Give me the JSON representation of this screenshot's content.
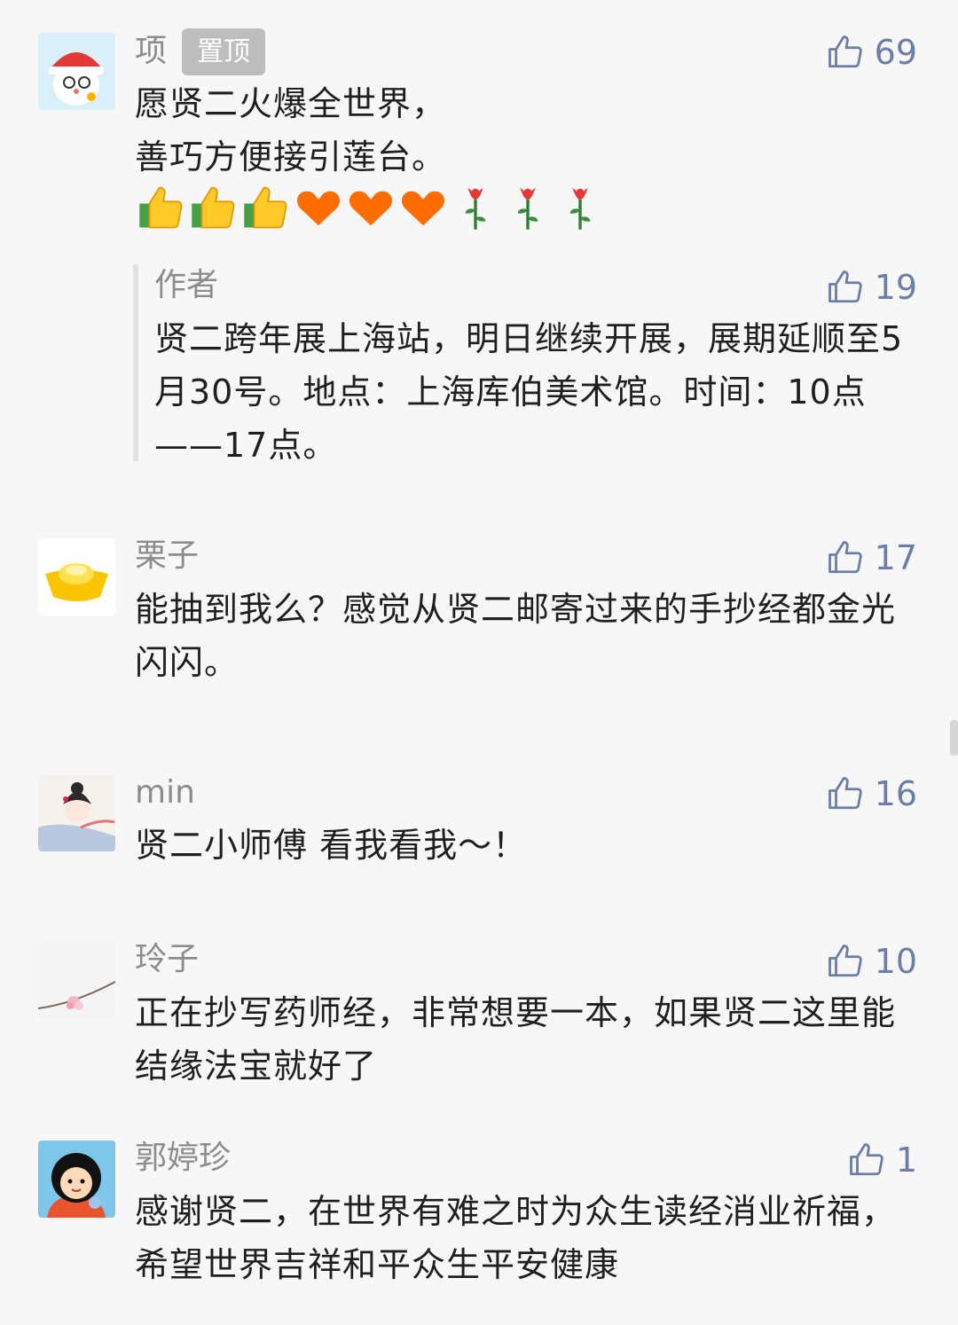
{
  "comments": [
    {
      "name": "项",
      "badge": "置顶",
      "likes": "69",
      "text": "愿贤二火爆全世界，\n善巧方便接引莲台。",
      "emojis": [
        "thumbs-up",
        "thumbs-up",
        "thumbs-up",
        "heart",
        "heart",
        "heart",
        "rose",
        "rose",
        "rose"
      ],
      "reply": {
        "name": "作者",
        "likes": "19",
        "text": "贤二跨年展上海站，明日继续开展，展期延顺至5月30号。地点：上海库伯美术馆。时间：10点——17点。"
      }
    },
    {
      "name": "栗子",
      "likes": "17",
      "text": "能抽到我么？感觉从贤二邮寄过来的手抄经都金光闪闪。"
    },
    {
      "name": "min",
      "likes": "16",
      "text": "贤二小师傅 看我看我～！"
    },
    {
      "name": "玲子",
      "likes": "10",
      "text": "正在抄写药师经，非常想要一本，如果贤二这里能结缘法宝就好了"
    },
    {
      "name": "郭婷珍",
      "likes": "1",
      "text": "感谢贤二，在世界有难之时为众生读经消业祈福，希望世界吉祥和平众生平安健康"
    }
  ],
  "colors": {
    "like": "#6b7ea8",
    "name": "#8c8c8c",
    "text": "#1f1f1f",
    "badge": "#bdbdbd"
  }
}
